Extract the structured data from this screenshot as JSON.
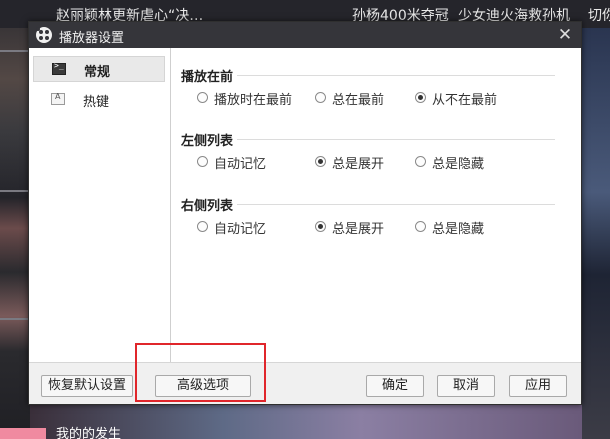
{
  "background": {
    "topbar": [
      "赵丽颖林更新虐心“决…",
      "孙杨400米夺冠",
      "少女迪火海救孙机",
      "切你"
    ],
    "bottom_text": "我的的发生"
  },
  "dialog": {
    "title": "播放器设置",
    "sidebar": {
      "items": [
        {
          "label": "常规",
          "icon": "terminal-icon",
          "active": true
        },
        {
          "label": "热键",
          "icon": "keyboard-icon",
          "active": false
        }
      ]
    },
    "groups": [
      {
        "title": "播放在前",
        "options": [
          "播放时在最前",
          "总在最前",
          "从不在最前"
        ],
        "selected": "从不在最前"
      },
      {
        "title": "左侧列表",
        "options": [
          "自动记忆",
          "总是展开",
          "总是隐藏"
        ],
        "selected": "总是展开"
      },
      {
        "title": "右侧列表",
        "options": [
          "自动记忆",
          "总是展开",
          "总是隐藏"
        ],
        "selected": "总是展开"
      }
    ],
    "footer": {
      "restore_label": "恢复默认设置",
      "advanced_label": "高级选项",
      "ok_label": "确定",
      "cancel_label": "取消",
      "apply_label": "应用"
    }
  },
  "colors": {
    "titlebar": "#35353a",
    "highlight": "#e0262b"
  }
}
